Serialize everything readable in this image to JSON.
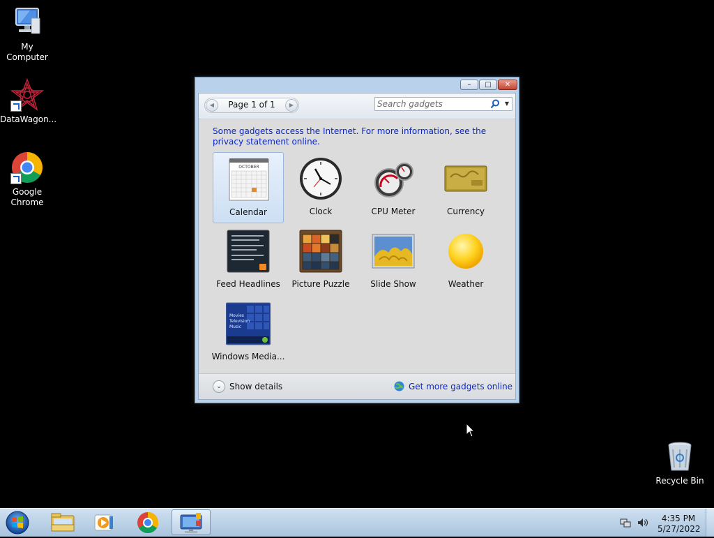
{
  "desktop": {
    "icons": [
      {
        "label": "My Computer",
        "icon": "computer-icon"
      },
      {
        "label": "DataWagon...",
        "icon": "datawagon-icon"
      },
      {
        "label": "Google Chrome",
        "icon": "chrome-icon"
      },
      {
        "label": "Recycle Bin",
        "icon": "recycle-bin-icon"
      }
    ]
  },
  "gadget_window": {
    "buttons": {
      "minimize": "–",
      "maximize": "□",
      "close": "✕"
    },
    "pager": {
      "text": "Page 1 of 1",
      "prev": "◀",
      "next": "▶"
    },
    "search": {
      "placeholder": "Search gadgets",
      "dropdown": "▼"
    },
    "info_text": "Some gadgets access the Internet.  For more information, see the privacy statement online.",
    "gadgets": [
      {
        "label": "Calendar",
        "selected": true
      },
      {
        "label": "Clock",
        "selected": false
      },
      {
        "label": "CPU Meter",
        "selected": false
      },
      {
        "label": "Currency",
        "selected": false
      },
      {
        "label": "Feed Headlines",
        "selected": false
      },
      {
        "label": "Picture Puzzle",
        "selected": false
      },
      {
        "label": "Slide Show",
        "selected": false
      },
      {
        "label": "Weather",
        "selected": false
      },
      {
        "label": "Windows Media...",
        "selected": false
      }
    ],
    "calendar_month": "OCTOBER",
    "media_menu": [
      "Movies",
      "Television",
      "Music"
    ],
    "show_details": "Show details",
    "details_chevron": "⌄",
    "get_more": "Get more gadgets online"
  },
  "taskbar": {
    "time": "4:35 PM",
    "date": "5/27/2022",
    "items": [
      "start-button",
      "file-explorer",
      "media-player",
      "chrome",
      "gadgets"
    ]
  },
  "colors": {
    "link": "#0b27c7",
    "window_frame": "#b9d1ea",
    "taskbar": "#a9c4de",
    "desktop": "#000000"
  }
}
